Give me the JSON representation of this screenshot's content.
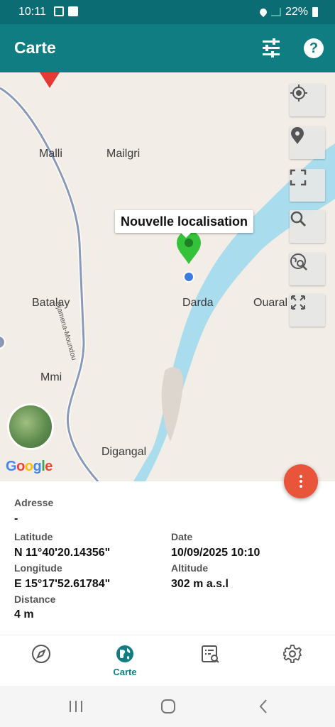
{
  "status_bar": {
    "time": "10:11",
    "battery": "22%",
    "icons": [
      "gallery-icon",
      "check-icon",
      "location-icon",
      "signal-icon",
      "battery-icon"
    ]
  },
  "app_bar": {
    "title": "Carte",
    "actions": [
      "filter-icon",
      "help-icon"
    ]
  },
  "map": {
    "places": [
      "Malli",
      "Mailgri",
      "Batalay",
      "Darda",
      "Ouaral",
      "Mmi",
      "Digangal"
    ],
    "road": "Djamena-Moundou",
    "marker_label": "Nouvelle localisation",
    "attribution": "Google",
    "controls": [
      "my-location-icon",
      "place-icon",
      "fullscreen-icon",
      "search-icon",
      "search-area-icon",
      "expand-icon"
    ],
    "colors": {
      "land": "#f2ede6",
      "water": "#a9dcec",
      "road": "#8a99b8",
      "marker": "#34c23a",
      "user_dot": "#3c7be0"
    }
  },
  "info": {
    "address_label": "Adresse",
    "address_value": "-",
    "latitude_label": "Latitude",
    "latitude_value": "N 11°40'20.14356\"",
    "longitude_label": "Longitude",
    "longitude_value": "E 15°17'52.61784\"",
    "distance_label": "Distance",
    "distance_value": "4 m",
    "date_label": "Date",
    "date_value": "10/09/2025 10:10",
    "altitude_label": "Altitude",
    "altitude_value": "302 m a.s.l"
  },
  "bottom_nav": {
    "items": [
      {
        "icon": "compass-icon",
        "label": ""
      },
      {
        "icon": "globe-icon",
        "label": "Carte",
        "active": true
      },
      {
        "icon": "list-search-icon",
        "label": ""
      },
      {
        "icon": "gear-icon",
        "label": ""
      }
    ],
    "accent": "#0f7d82"
  }
}
